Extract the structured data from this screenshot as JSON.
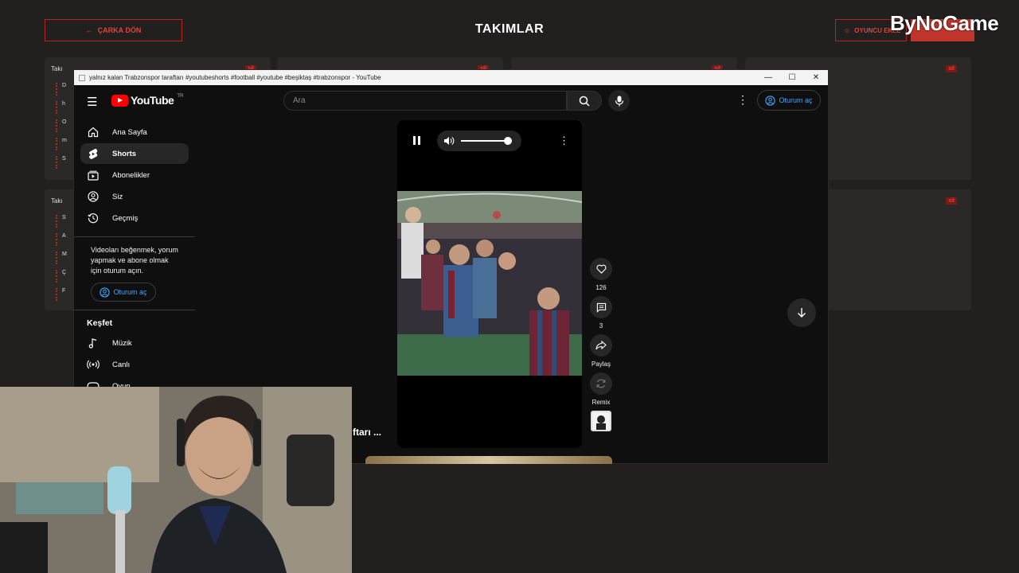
{
  "background_app": {
    "back_button": "ÇARKA DÖN",
    "title": "TAKIMLAR",
    "add_button": "OYUNCU EKLE",
    "delete_badge": "sil",
    "card_title_visible": "Takı",
    "row_letters": [
      "D",
      "h",
      "O",
      "m",
      "S"
    ],
    "row_letters_b": [
      "S",
      "A",
      "M",
      "Ç",
      "F"
    ]
  },
  "watermark": "ByNoGame",
  "window": {
    "title": "yalnız kalan Trabzonspor taraftarı #youtubeshorts #football #youtube #beşiktaş #trabzonspor - YouTube",
    "controls": [
      "—",
      "☐",
      "✕"
    ]
  },
  "youtube": {
    "logo_text": "YouTube",
    "logo_region": "TR",
    "search_placeholder": "Ara",
    "signin_label": "Oturum aç",
    "nav": [
      {
        "label": "Ana Sayfa",
        "icon": "home-icon"
      },
      {
        "label": "Shorts",
        "icon": "shorts-icon"
      },
      {
        "label": "Abonelikler",
        "icon": "subscriptions-icon"
      },
      {
        "label": "Siz",
        "icon": "you-icon"
      },
      {
        "label": "Geçmiş",
        "icon": "history-icon"
      }
    ],
    "signin_note": "Videoları beğenmek, yorum yapmak ve abone olmak için oturum açın.",
    "signin_side_label": "Oturum aç",
    "explore_title": "Keşfet",
    "explore": [
      {
        "label": "Müzik",
        "icon": "music-icon"
      },
      {
        "label": "Canlı",
        "icon": "live-icon"
      },
      {
        "label": "Oyun",
        "icon": "gaming-icon"
      }
    ],
    "short_actions": {
      "likes": "126",
      "comments": "3",
      "share": "Paylaş",
      "remix": "Remix"
    },
    "overlay_title": "ftarı ..."
  },
  "volume_level": 0.9
}
